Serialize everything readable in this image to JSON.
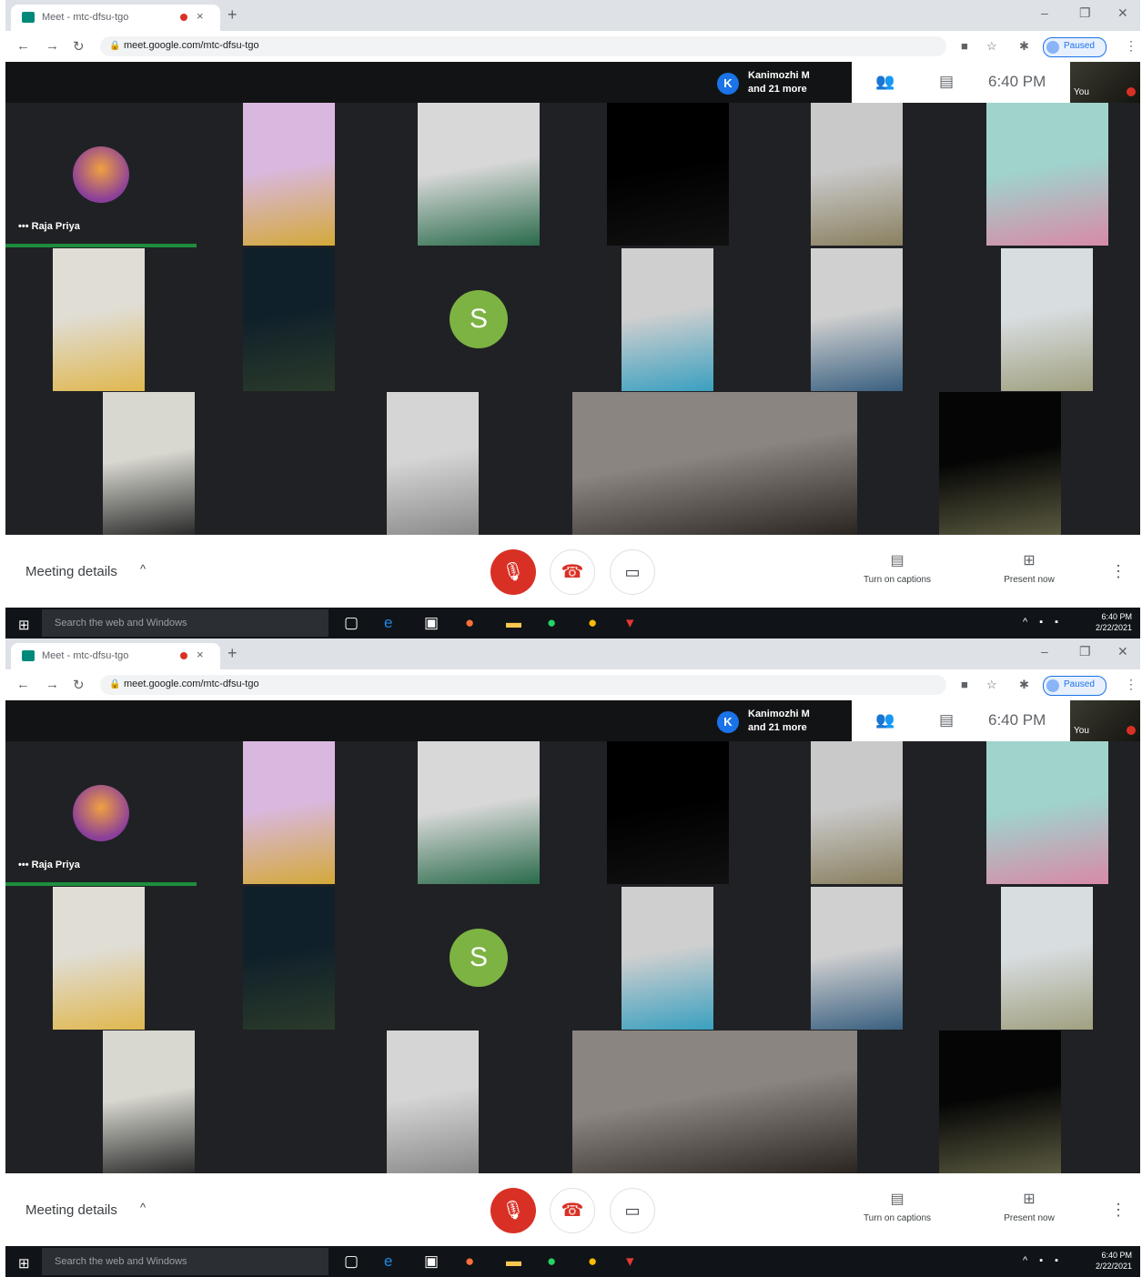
{
  "browser": {
    "tab_title": "Meet - mtc-dfsu-tgo",
    "tab_close": "×",
    "new_tab": "+",
    "minimize": "–",
    "restore": "❐",
    "close": "✕",
    "back": "←",
    "forward": "→",
    "reload": "↻",
    "lock": "🔒",
    "url": "meet.google.com/mtc-dfsu-tgo",
    "profile_status": "Paused",
    "menu": "⋮"
  },
  "meet": {
    "people_avatar_letter": "K",
    "people_line1": "Kanimozhi M",
    "people_line2": "and 21 more",
    "people_icon": "👥",
    "chat_icon": "▤",
    "time": "6:40 PM",
    "self_label": "You",
    "speaker_name": "Raja Priya",
    "speaker_dots": "•••",
    "avatar_s_letter": "S",
    "meeting_details": "Meeting details",
    "caret": "^",
    "mic_glyph": "🎙",
    "end_glyph": "☎",
    "cam_glyph": "▭",
    "captions_icon": "▤",
    "captions_label": "Turn on captions",
    "present_icon": "⊞",
    "present_label": "Present now",
    "more": "⋮"
  },
  "taskbar": {
    "start": "⊞",
    "search_placeholder": "Search the web and Windows",
    "tray": "^ ▪ ▪",
    "time": "6:40 PM",
    "date": "2/22/2021"
  },
  "tiles": [
    {
      "name": "tile-participant-1",
      "colors": [
        "#d9b8e0",
        "#d4a93a"
      ]
    },
    {
      "name": "tile-participant-2",
      "colors": [
        "#d8d8d8",
        "#2a6b4b"
      ]
    },
    {
      "name": "tile-participant-3",
      "colors": [
        "#000000",
        "#111111"
      ]
    },
    {
      "name": "tile-participant-4",
      "colors": [
        "#c9c9c9",
        "#8a8060"
      ]
    },
    {
      "name": "tile-participant-5",
      "colors": [
        "#9fd3cc",
        "#d88aa8"
      ]
    },
    {
      "name": "tile-participant-6",
      "colors": [
        "#e0ddd5",
        "#e0b850"
      ]
    },
    {
      "name": "tile-participant-7",
      "colors": [
        "#10202a",
        "#2a3a2a"
      ]
    },
    {
      "name": "tile-participant-8",
      "colors": [
        "#cfcfcf",
        "#3aa0c0"
      ]
    },
    {
      "name": "tile-participant-9",
      "colors": [
        "#d0d0d0",
        "#3a6080"
      ]
    },
    {
      "name": "tile-participant-10",
      "colors": [
        "#d8dde0",
        "#a0a080"
      ]
    },
    {
      "name": "tile-participant-11",
      "colors": [
        "#d8d8d0",
        "#2a2a2a"
      ]
    },
    {
      "name": "tile-participant-12",
      "colors": [
        "#d5d5d5",
        "#8a8a8a"
      ]
    },
    {
      "name": "tile-participant-13",
      "colors": [
        "#8a8580",
        "#2a2520"
      ]
    },
    {
      "name": "tile-participant-14",
      "colors": [
        "#050505",
        "#5a5a40"
      ]
    }
  ]
}
